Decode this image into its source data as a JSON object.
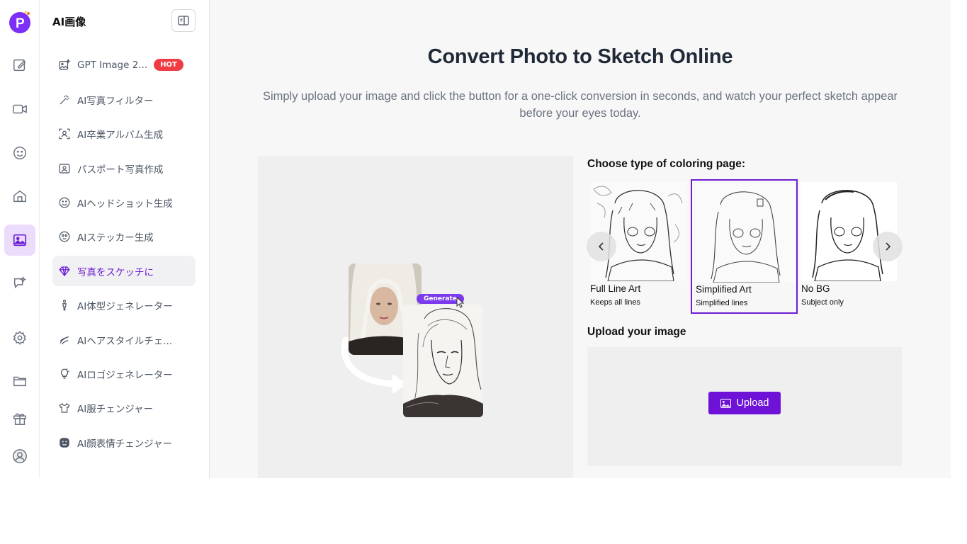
{
  "colors": {
    "accent": "#6d1ed4",
    "hot": "#ef3b44",
    "upload_button": "#6d12d6"
  },
  "rail": {
    "icons": [
      "logo-icon",
      "edit-icon",
      "video-icon",
      "smile-icon",
      "home-icon",
      "image-icon",
      "chat-icon",
      "gear-icon",
      "folder-icon",
      "gift-icon",
      "user-icon"
    ],
    "active": "image-icon"
  },
  "nav": {
    "title": "AI画像",
    "items": [
      {
        "label": "GPT Image 2...",
        "icon": "image-sparkle-icon",
        "badge": "HOT"
      },
      {
        "label": "AI写真フィルター",
        "icon": "magic-wand-icon"
      },
      {
        "label": "AI卒業アルバム生成",
        "icon": "portrait-icon"
      },
      {
        "label": "パスポート写真作成",
        "icon": "id-card-icon"
      },
      {
        "label": "AIヘッドショット生成",
        "icon": "smile-icon"
      },
      {
        "label": "AIステッカー生成",
        "icon": "sticker-icon"
      },
      {
        "label": "写真をスケッチに",
        "icon": "diamond-icon",
        "active": true
      },
      {
        "label": "AI体型ジェネレーター",
        "icon": "body-icon"
      },
      {
        "label": "AIヘアスタイルチェ...",
        "icon": "hair-icon"
      },
      {
        "label": "AIロゴジェネレーター",
        "icon": "lightbulb-icon"
      },
      {
        "label": "AI服チェンジャー",
        "icon": "shirt-icon"
      },
      {
        "label": "AI顔表情チェンジャー",
        "icon": "face-icon"
      }
    ]
  },
  "main": {
    "title": "Convert Photo to Sketch Online",
    "subtitle": "Simply upload your image and click the button for a one-click conversion in seconds, and watch your perfect sketch appear before your eyes today.",
    "preview_button": "Generate",
    "choose_heading": "Choose type of coloring page:",
    "styles": [
      {
        "name": "Full Line Art",
        "desc": "Keeps all lines"
      },
      {
        "name": "Simplified Art",
        "desc": "Simplified lines",
        "selected": true
      },
      {
        "name": "No BG",
        "desc": "Subject only"
      }
    ],
    "upload_heading": "Upload your image",
    "upload_label": "Upload"
  }
}
